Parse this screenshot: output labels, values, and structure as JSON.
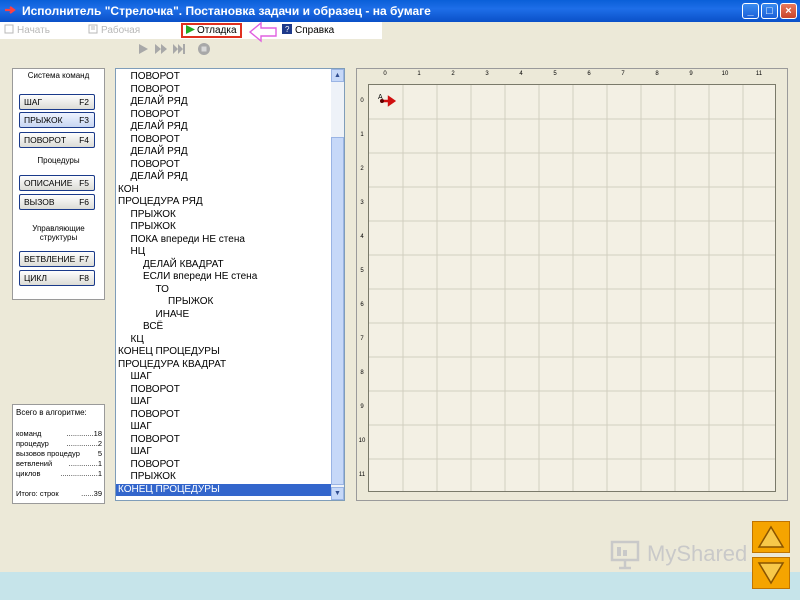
{
  "window": {
    "title": "Исполнитель \"Стрелочка\". Постановка задачи и образец - на бумаге"
  },
  "menu": {
    "start": "Начать",
    "workbook": "Рабочая",
    "debug": "Отладка",
    "help": "Справка"
  },
  "commands": {
    "system_caption": "Система команд",
    "step": {
      "label": "ШАГ",
      "key": "F2"
    },
    "jump": {
      "label": "ПРЫЖОК",
      "key": "F3"
    },
    "turn": {
      "label": "ПОВОРОТ",
      "key": "F4"
    },
    "procedures_caption": "Процедуры",
    "describe": {
      "label": "ОПИСАНИЕ",
      "key": "F5"
    },
    "call": {
      "label": "ВЫЗОВ",
      "key": "F6"
    },
    "control_caption": "Управляющие структуры",
    "branch": {
      "label": "ВЕТВЛЕНИЕ",
      "key": "F7"
    },
    "loop": {
      "label": "ЦИКЛ",
      "key": "F8"
    }
  },
  "stats": {
    "heading": "Всего в алгоритме:",
    "rows": [
      {
        "label": "команд",
        "value": ".............18"
      },
      {
        "label": "процедур",
        "value": "...............2"
      },
      {
        "label": "вызовов процедур",
        "value": "5"
      },
      {
        "label": "ветвлений",
        "value": "..............1"
      },
      {
        "label": "циклов",
        "value": "..................1"
      }
    ],
    "total_label": "Итого: строк",
    "total_value": "......39"
  },
  "code_lines": [
    {
      "text": "ПОВОРОТ",
      "indent": 1
    },
    {
      "text": "ПОВОРОТ",
      "indent": 1
    },
    {
      "text": "ДЕЛАЙ РЯД",
      "indent": 1
    },
    {
      "text": "ПОВОРОТ",
      "indent": 1
    },
    {
      "text": "ДЕЛАЙ РЯД",
      "indent": 1
    },
    {
      "text": "ПОВОРОТ",
      "indent": 1
    },
    {
      "text": "ДЕЛАЙ РЯД",
      "indent": 1
    },
    {
      "text": "ПОВОРОТ",
      "indent": 1
    },
    {
      "text": "ДЕЛАЙ РЯД",
      "indent": 1
    },
    {
      "text": "КОН",
      "indent": 0
    },
    {
      "text": "ПРОЦЕДУРА РЯД",
      "indent": 0
    },
    {
      "text": "ПРЫЖОК",
      "indent": 1
    },
    {
      "text": "ПРЫЖОК",
      "indent": 1
    },
    {
      "text": "ПОКА впереди НЕ стена",
      "indent": 1
    },
    {
      "text": "НЦ",
      "indent": 1
    },
    {
      "text": "ДЕЛАЙ КВАДРАТ",
      "indent": 2
    },
    {
      "text": "ЕСЛИ впереди НЕ стена",
      "indent": 2
    },
    {
      "text": "ТО",
      "indent": 3
    },
    {
      "text": "ПРЫЖОК",
      "indent": 4
    },
    {
      "text": "ИНАЧЕ",
      "indent": 3
    },
    {
      "text": "ВСЁ",
      "indent": 2
    },
    {
      "text": "КЦ",
      "indent": 1
    },
    {
      "text": "КОНЕЦ ПРОЦЕДУРЫ",
      "indent": 0
    },
    {
      "text": "ПРОЦЕДУРА КВАДРАТ",
      "indent": 0
    },
    {
      "text": "ШАГ",
      "indent": 1
    },
    {
      "text": "ПОВОРОТ",
      "indent": 1
    },
    {
      "text": "ШАГ",
      "indent": 1
    },
    {
      "text": "ПОВОРОТ",
      "indent": 1
    },
    {
      "text": "ШАГ",
      "indent": 1
    },
    {
      "text": "ПОВОРОТ",
      "indent": 1
    },
    {
      "text": "ШАГ",
      "indent": 1
    },
    {
      "text": "ПОВОРОТ",
      "indent": 1
    },
    {
      "text": "ПРЫЖОК",
      "indent": 1
    },
    {
      "text": "КОНЕЦ ПРОЦЕДУРЫ",
      "indent": 0,
      "selected": true
    }
  ],
  "field": {
    "col_labels": [
      "0",
      "1",
      "2",
      "3",
      "4",
      "5",
      "6",
      "7",
      "8",
      "9",
      "10",
      "11"
    ],
    "row_labels": [
      "0",
      "1",
      "2",
      "3",
      "4",
      "5",
      "6",
      "7",
      "8",
      "9",
      "10",
      "11"
    ],
    "arrow_label": "А",
    "arrow_position": {
      "col": 0,
      "row": 0
    },
    "arrow_direction": "east"
  },
  "watermark": {
    "text": "MyShared"
  },
  "colors": {
    "titlebar": "#0a5fd8",
    "selection": "#3366cc",
    "highlight_border": "#e03020",
    "nav_button": "#f5a400",
    "arrow": "#d01010",
    "bottom_strip": "#c6e4ea"
  },
  "icons": {
    "play": "play-icon",
    "fast_forward": "fast-forward-icon",
    "step_forward": "step-forward-icon",
    "stop": "stop-icon",
    "up": "triangle-up-icon",
    "down": "triangle-down-icon"
  }
}
